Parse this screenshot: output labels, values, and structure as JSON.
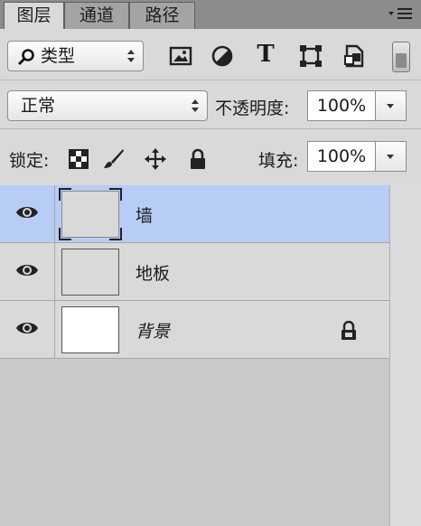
{
  "tabs": [
    {
      "label": "图层",
      "active": true
    },
    {
      "label": "通道",
      "active": false
    },
    {
      "label": "路径",
      "active": false
    }
  ],
  "filter": {
    "kind_label": "类型",
    "filter_icons": [
      "image-filter-icon",
      "adjustment-filter-icon",
      "type-filter-icon",
      "shape-filter-icon",
      "smart-object-filter-icon"
    ],
    "type_icon_glyph": "T"
  },
  "blend": {
    "mode": "正常",
    "opacity_label": "不透明度:",
    "opacity_value": "100%"
  },
  "lock": {
    "label": "锁定:",
    "fill_label": "填充:",
    "fill_value": "100%",
    "lock_icons": [
      "lock-transparent-pixels-icon",
      "lock-image-pixels-icon",
      "lock-position-icon",
      "lock-all-icon"
    ]
  },
  "layers": [
    {
      "name": "墙",
      "selected": true,
      "visible": true,
      "locked": false,
      "italic": false
    },
    {
      "name": "地板",
      "selected": false,
      "visible": true,
      "locked": false,
      "italic": false
    },
    {
      "name": "背景",
      "selected": false,
      "visible": true,
      "locked": true,
      "italic": true
    }
  ],
  "colors": {
    "selected_row": "#b7cdf5",
    "panel_bg": "#d9d9d9",
    "tab_bar": "#8c8c8c"
  }
}
